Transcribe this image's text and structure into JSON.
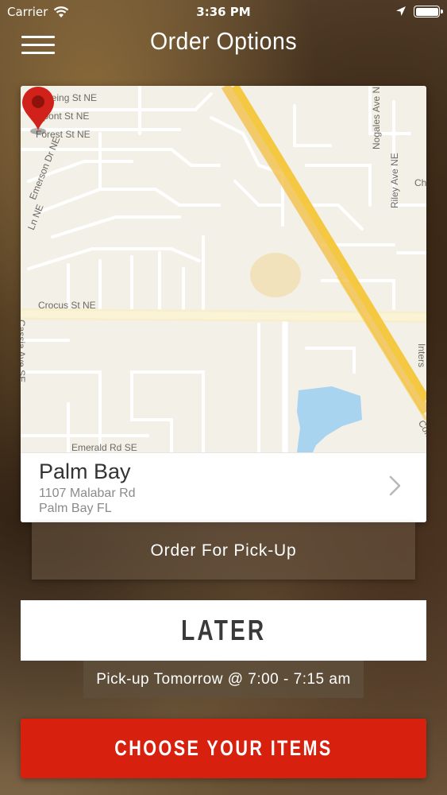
{
  "status_bar": {
    "carrier": "Carrier",
    "time": "3:36 PM"
  },
  "header": {
    "title": "Order Options",
    "menu_icon": "hamburger-menu-icon"
  },
  "map": {
    "street_labels": [
      "Boeing St NE",
      "Dupont St NE",
      "Forest St NE",
      "Emerson Dr NE",
      "Ln NE",
      "Crocus St NE",
      "Cassia Ave SE",
      "Emerald Rd SE",
      "Nogales Ave NE",
      "Riley Ave NE",
      "Ch",
      "Inters",
      "Com"
    ],
    "pin_icon": "map-pin-icon",
    "colors": {
      "land": "#f3f0e8",
      "road": "#ffffff",
      "highway": "#f5c842",
      "water": "#a8d4f0",
      "pin": "#d0221a"
    }
  },
  "store": {
    "name": "Palm Bay",
    "address_line1": "1107 Malabar Rd",
    "address_line2": "Palm Bay FL",
    "chevron_icon": "chevron-right-icon"
  },
  "order_type": {
    "label": "Order For Pick-Up"
  },
  "timing": {
    "label": "LATER",
    "pickup_time": "Pick-up Tomorrow @ 7:00 - 7:15 am"
  },
  "cta": {
    "label": "CHOOSE YOUR ITEMS",
    "color": "#d8200f"
  }
}
